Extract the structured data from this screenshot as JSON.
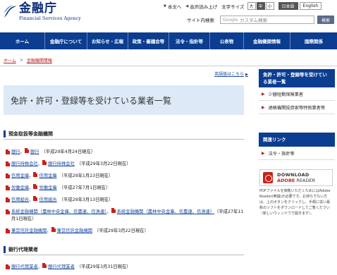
{
  "brand": {
    "name_ja": "金融庁",
    "name_en": "Financial Services Agency"
  },
  "utility": {
    "text_only": "本文へ",
    "read_aloud": "音声読み上げ",
    "font_size_label": "文字サイズ",
    "font_sizes": [
      "大",
      "中",
      "小"
    ],
    "langs": [
      "日本語",
      "English"
    ]
  },
  "search": {
    "label": "サイト内検索",
    "placeholder": "カスタム検索",
    "google": "Google",
    "button": "検索"
  },
  "nav": [
    "ホーム",
    "金融庁について",
    "お知らせ・広報",
    "政策・審議会等",
    "法令・指針等",
    "公表物",
    "金融機関情報",
    "国際関係"
  ],
  "breadcrumb": {
    "home": "ホーム",
    "sep": ">",
    "current": "金融機関情報"
  },
  "english_link": "英語版はこちら",
  "page_title": "免許・許可・登録等を受けている業者一覧",
  "section1": {
    "title": "預金取扱等金融機関",
    "items": [
      {
        "links": [
          "銀行",
          "銀行"
        ],
        "note": "（平成29年4月24日現在）"
      },
      {
        "links": [
          "銀行持株会社",
          "銀行持株会社"
        ],
        "note": "（平成29年3月22日現在）"
      },
      {
        "links": [
          "信用金庫",
          "信用金庫"
        ],
        "note": "（平成29年1月23日現在）"
      },
      {
        "links": [
          "労働金庫",
          "労働金庫"
        ],
        "note": "（平成27年7月1日現在）"
      },
      {
        "links": [
          "信用組合",
          "信用組合"
        ],
        "note": "（平成29年3月13日現在）"
      },
      {
        "links": [
          "系統金融機関（農林中央金庫、信農連、信漁連）",
          "系統金融機関（農林中央金庫、信農連、信漁連）"
        ],
        "note": "（平成27年11月1日現在）"
      },
      {
        "links": [
          "兼営信託金融機関",
          "兼営信託金融機関"
        ],
        "note": "（平成29年3月22日現在）"
      }
    ]
  },
  "section2": {
    "title": "銀行代理業者",
    "note": "（平成29年3月31日現在）",
    "items": [
      {
        "links": [
          "銀行代理業者",
          "銀行代理業者"
        ],
        "note": "（平成29年3月31日現在）"
      }
    ]
  },
  "sidebar": {
    "menu_title": "免許・許可・登録等を受けている業者一覧",
    "menu_items": [
      "少額短期保険業者",
      "適格機関投資家等特例業者等"
    ],
    "links_title": "関連リンク",
    "links": [
      "法令・指針等"
    ]
  },
  "reader": {
    "download": "DOWNLOAD",
    "adobe": "ADOBE",
    "reader": "READER",
    "note": "PDFファイルを御覧いただくためにはAdobe Reader(無償)が必要です。お持ちでない方は、上のボタンをクリックし、手順に従い最新のソフトをダウンロードしてご覧ください（新しいウィンドウで開きます）。"
  },
  "colors": {
    "nav_bg": "#0b3d91",
    "title_bg": "#dde9f6",
    "pdf_red": "#c8221a"
  }
}
